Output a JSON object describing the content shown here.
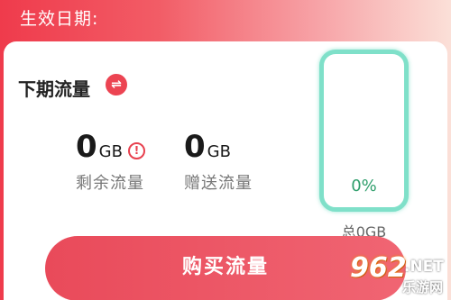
{
  "header": {
    "effective_date_label": "生效日期:"
  },
  "next_period": {
    "title": "下期流量",
    "swap_icon": "swap-arrows-icon",
    "swap_glyph": "⇌"
  },
  "remaining": {
    "value": "0",
    "unit": "GB",
    "label": "剩余流量",
    "info_glyph": "!"
  },
  "gifted": {
    "value": "0",
    "unit": "GB",
    "label": "赠送流量"
  },
  "gauge": {
    "percent_text": "0%",
    "fill_fraction": 0,
    "total_label": "总0GB"
  },
  "buy_button": {
    "label": "购买流量"
  },
  "watermark": {
    "logo": "962",
    "net": ".NET",
    "site": "乐游网"
  },
  "colors": {
    "accent": "#ec4452",
    "gauge_border": "#7fe0c9",
    "percent_text": "#2e9e6b"
  }
}
